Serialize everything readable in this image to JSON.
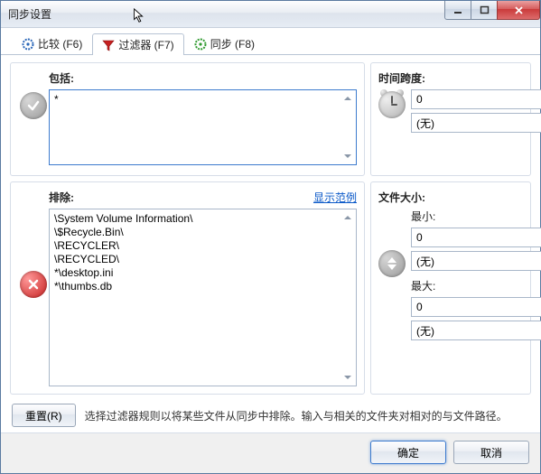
{
  "window": {
    "title": "同步设置"
  },
  "tabs": {
    "compare": "比较 (F6)",
    "filter": "过滤器 (F7)",
    "sync": "同步 (F8)"
  },
  "include": {
    "label": "包括:",
    "value": "*"
  },
  "exclude": {
    "label": "排除:",
    "show_example": "显示范例",
    "value": "\\System Volume Information\\\n\\$Recycle.Bin\\\n\\RECYCLER\\\n\\RECYCLED\\\n*\\desktop.ini\n*\\thumbs.db"
  },
  "timespan": {
    "label": "时间跨度:",
    "value": "0",
    "unit": "(无)"
  },
  "filesize": {
    "label": "文件大小:",
    "min_label": "最小:",
    "min_value": "0",
    "min_unit": "(无)",
    "max_label": "最大:",
    "max_value": "0",
    "max_unit": "(无)"
  },
  "footer": {
    "reset": "重置(R)",
    "hint": "选择过滤器规则以将某些文件从同步中排除。输入与相关的文件夹对相对的与文件路径。"
  },
  "buttons": {
    "ok": "确定",
    "cancel": "取消"
  }
}
